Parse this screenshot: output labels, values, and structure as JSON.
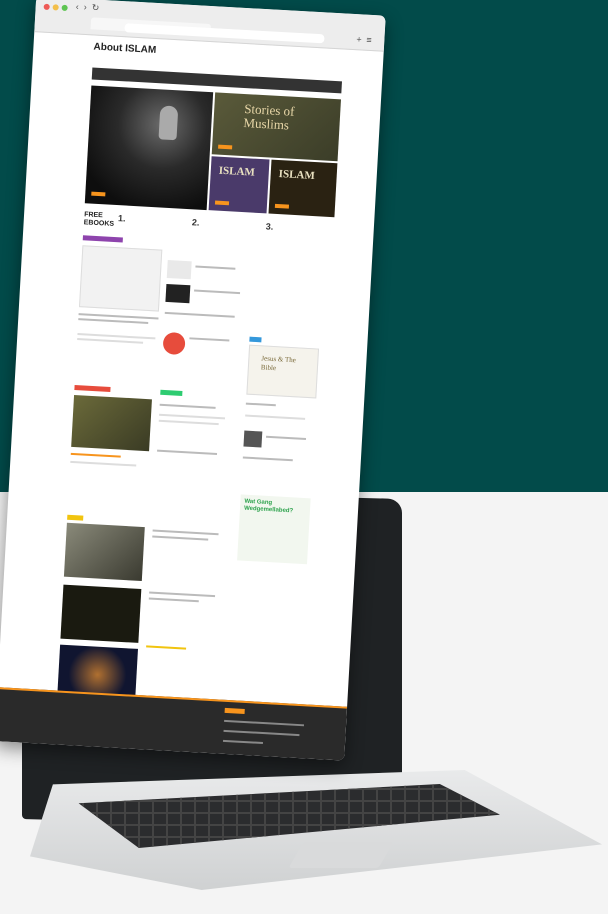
{
  "browser": {
    "icons": [
      "back-icon",
      "forward-icon",
      "reload-icon",
      "plus-icon",
      "menu-icon"
    ]
  },
  "site": {
    "title": "About ISLAM"
  },
  "hero": {
    "stories_title": "Stories of Muslims",
    "islam_title": "ISLAM",
    "islam2_title": "ISLAM"
  },
  "free_books": {
    "title": "FREE EBOOKS",
    "items": [
      {
        "num": "1."
      },
      {
        "num": "2."
      },
      {
        "num": "3."
      }
    ]
  },
  "sidebar": {
    "jesus_title": "Jesus & The Bible",
    "ad_title": "Wat Gang Wedgemellabed?"
  },
  "colors": {
    "teal_bg": "#024b4a",
    "accent": "#f7941d",
    "badge_purple": "#8e44ad",
    "badge_red": "#e74c3c",
    "badge_green": "#2ecc71",
    "badge_blue": "#3498db",
    "badge_yellow": "#f1c40f"
  }
}
